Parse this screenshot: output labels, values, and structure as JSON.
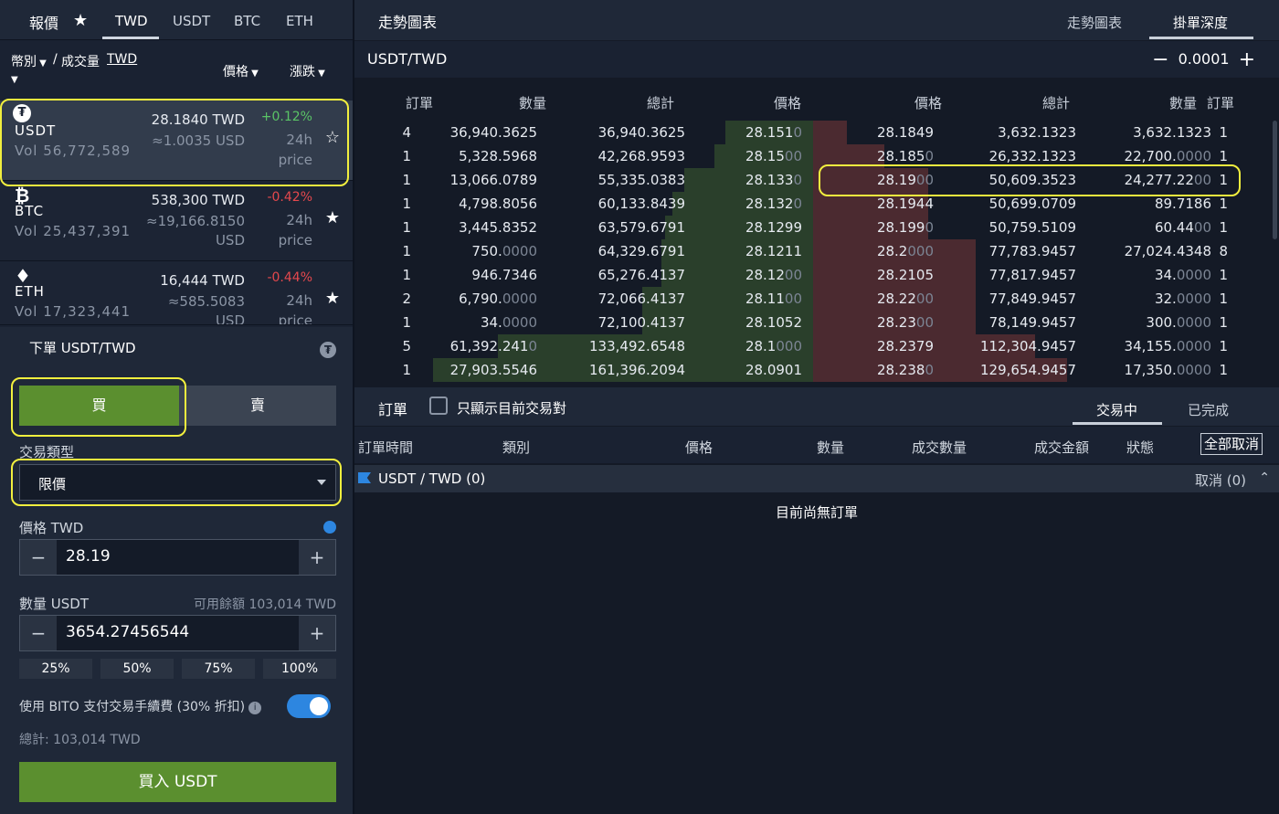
{
  "quote": {
    "title": "報價",
    "tabs": [
      "TWD",
      "USDT",
      "BTC",
      "ETH"
    ],
    "sort": {
      "currency": "幣別",
      "separator": "/",
      "volume": "成交量",
      "volume_unit": "TWD",
      "price": "價格",
      "change": "漲跌"
    }
  },
  "coins": [
    {
      "symbol": "USDT",
      "icon": "tether-icon",
      "vol": "Vol  56,772,589",
      "price": "28.1840 TWD",
      "usd": "≈1.0035 USD",
      "usd2": "",
      "change": "+0.12%",
      "dir": "up",
      "h24": "24h",
      "plabel": "price"
    },
    {
      "symbol": "BTC",
      "icon": "bitcoin-icon",
      "vol": "Vol  25,437,391",
      "price": "538,300 TWD",
      "usd": "≈19,166.8150",
      "usd2": "USD",
      "change": "-0.42%",
      "dir": "down",
      "h24": "24h",
      "plabel": "price"
    },
    {
      "symbol": "ETH",
      "icon": "ethereum-icon",
      "vol": "Vol  17,323,441",
      "price": "16,444 TWD",
      "usd": "≈585.5083",
      "usd2": "USD",
      "change": "-0.44%",
      "dir": "down",
      "h24": "24h",
      "plabel": "price"
    }
  ],
  "form": {
    "title": "下單  USDT/TWD",
    "buy": "買",
    "sell": "賣",
    "type_label": "交易類型",
    "type_value": "限價",
    "price_label": "價格 TWD",
    "price_value": "28.19",
    "qty_label": "數量 USDT",
    "available": "可用餘額 103,014 TWD",
    "qty_value": "3654.27456544",
    "pcts": [
      "25%",
      "50%",
      "75%",
      "100%"
    ],
    "fee_label": "使用 BITO 支付交易手續費 (30% 折扣)",
    "total": "總計: 103,014 TWD",
    "submit": "買入 USDT"
  },
  "chart_header": {
    "title": "走勢圖表",
    "tabs": [
      "走勢圖表",
      "掛單深度"
    ]
  },
  "pair": "USDT/TWD",
  "precision": "0.0001",
  "book_headers": [
    "訂單",
    "數量",
    "總計",
    "價格",
    "價格",
    "總計",
    "數量",
    "訂單"
  ],
  "bids": [
    {
      "orders": "4",
      "qty": "36,940.3625",
      "qtyDim": "",
      "total": "36,940.3625",
      "price": "28.151",
      "priceDim": "0",
      "depth": 0.23
    },
    {
      "orders": "1",
      "qty": "5,328.5968",
      "qtyDim": "",
      "total": "42,268.9593",
      "price": "28.15",
      "priceDim": "00",
      "depth": 0.26
    },
    {
      "orders": "1",
      "qty": "13,066.0789",
      "qtyDim": "",
      "total": "55,335.0383",
      "price": "28.133",
      "priceDim": "0",
      "depth": 0.34
    },
    {
      "orders": "1",
      "qty": "4,798.8056",
      "qtyDim": "",
      "total": "60,133.8439",
      "price": "28.132",
      "priceDim": "0",
      "depth": 0.37
    },
    {
      "orders": "1",
      "qty": "3,445.8352",
      "qtyDim": "",
      "total": "63,579.6791",
      "price": "28.1299",
      "priceDim": "",
      "depth": 0.39
    },
    {
      "orders": "1",
      "qty": "750.",
      "qtyDim": "0000",
      "total": "64,329.6791",
      "price": "28.1211",
      "priceDim": "",
      "depth": 0.4
    },
    {
      "orders": "1",
      "qty": "946.7346",
      "qtyDim": "",
      "total": "65,276.4137",
      "price": "28.12",
      "priceDim": "00",
      "depth": 0.4
    },
    {
      "orders": "2",
      "qty": "6,790.",
      "qtyDim": "0000",
      "total": "72,066.4137",
      "price": "28.11",
      "priceDim": "00",
      "depth": 0.45
    },
    {
      "orders": "1",
      "qty": "34.",
      "qtyDim": "0000",
      "total": "72,100.4137",
      "price": "28.1052",
      "priceDim": "",
      "depth": 0.45
    },
    {
      "orders": "5",
      "qty": "61,392.241",
      "qtyDim": "0",
      "total": "133,492.6548",
      "price": "28.1",
      "priceDim": "000",
      "depth": 0.83
    },
    {
      "orders": "1",
      "qty": "27,903.5546",
      "qtyDim": "",
      "total": "161,396.2094",
      "price": "28.0901",
      "priceDim": "",
      "depth": 1.0
    }
  ],
  "asks": [
    {
      "price": "28.1849",
      "priceDim": "",
      "total": "3,632.1323",
      "qty": "3,632.1323",
      "qtyDim": "",
      "orders": "1",
      "depth": 0.02
    },
    {
      "price": "28.185",
      "priceDim": "0",
      "total": "26,332.1323",
      "qty": "22,700.",
      "qtyDim": "0000",
      "orders": "1",
      "depth": 0.14
    },
    {
      "price": "28.19",
      "priceDim": "00",
      "total": "50,609.3523",
      "qty": "24,277.22",
      "qtyDim": "00",
      "orders": "1",
      "depth": 0.28
    },
    {
      "price": "28.1944",
      "priceDim": "",
      "total": "50,699.0709",
      "qty": "89.7186",
      "qtyDim": "",
      "orders": "1",
      "depth": 0.28
    },
    {
      "price": "28.199",
      "priceDim": "0",
      "total": "50,759.5109",
      "qty": "60.44",
      "qtyDim": "00",
      "orders": "1",
      "depth": 0.28
    },
    {
      "price": "28.2",
      "priceDim": "000",
      "total": "77,783.9457",
      "qty": "27,024.4348",
      "qtyDim": "",
      "orders": "8",
      "depth": 0.43
    },
    {
      "price": "28.2105",
      "priceDim": "",
      "total": "77,817.9457",
      "qty": "34.",
      "qtyDim": "0000",
      "orders": "1",
      "depth": 0.43
    },
    {
      "price": "28.22",
      "priceDim": "00",
      "total": "77,849.9457",
      "qty": "32.",
      "qtyDim": "0000",
      "orders": "1",
      "depth": 0.43
    },
    {
      "price": "28.23",
      "priceDim": "00",
      "total": "78,149.9457",
      "qty": "300.",
      "qtyDim": "0000",
      "orders": "1",
      "depth": 0.43
    },
    {
      "price": "28.2379",
      "priceDim": "",
      "total": "112,304.9457",
      "qty": "34,155.",
      "qtyDim": "0000",
      "orders": "1",
      "depth": 0.62
    },
    {
      "price": "28.238",
      "priceDim": "0",
      "total": "129,654.9457",
      "qty": "17,350.",
      "qtyDim": "0000",
      "orders": "1",
      "depth": 0.72
    }
  ],
  "orders": {
    "title": "訂單",
    "filter_label": "只顯示目前交易對",
    "tabs": [
      "交易中",
      "已完成"
    ],
    "columns": [
      "訂單時間",
      "類別",
      "價格",
      "數量",
      "成交數量",
      "成交金額",
      "狀態"
    ],
    "cancel_all": "全部取消",
    "group": "USDT / TWD (0)",
    "group_cancel": "取消 (0)",
    "empty": "目前尚無訂單"
  },
  "colors": {
    "buy": "#5b8f2f",
    "up": "#5ac466",
    "down": "#e5484d",
    "highlight": "#f2ef3e",
    "accent": "#2d86e0"
  }
}
